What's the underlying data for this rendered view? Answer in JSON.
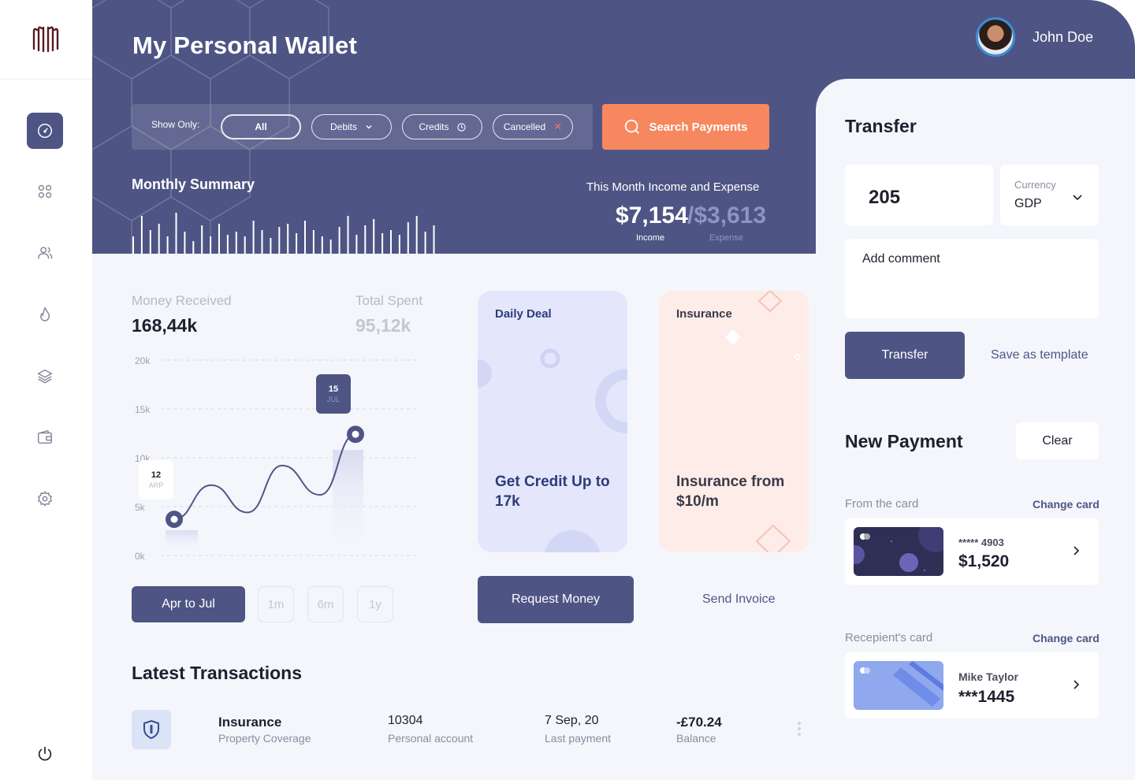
{
  "app": {
    "title": "My Personal Wallet"
  },
  "user": {
    "name": "John Doe"
  },
  "sidebar": {
    "items": [
      {
        "icon": "gauge-icon"
      },
      {
        "icon": "grid-icon"
      },
      {
        "icon": "users-icon"
      },
      {
        "icon": "flame-icon"
      },
      {
        "icon": "layers-icon"
      },
      {
        "icon": "wallet-icon"
      },
      {
        "icon": "gear-icon"
      }
    ],
    "logout_icon": "power-icon"
  },
  "filters": {
    "label": "Show Only:",
    "options": [
      {
        "label": "All",
        "active": true
      },
      {
        "label": "Debits",
        "icon": "chevron-down-icon"
      },
      {
        "label": "Credits",
        "icon": "clock-icon"
      },
      {
        "label": "Cancelled",
        "icon": "close-icon"
      }
    ],
    "search_label": "Search Payments"
  },
  "summary": {
    "title": "Monthly Summary",
    "period_title": "This Month Income and Expense",
    "income_value": "$7,154",
    "income_label": "Income",
    "expense_value": "/$3,613",
    "expense_label": "Expense"
  },
  "stats": {
    "received_label": "Money Received",
    "received_value": "168,44k",
    "spent_label": "Total Spent",
    "spent_value": "95,12k"
  },
  "chart_data": {
    "type": "line",
    "y_ticks": [
      "20k",
      "15k",
      "10k",
      "5k",
      "0k"
    ],
    "ylim": [
      0,
      20
    ],
    "series": [
      {
        "values": [
          3.7,
          7.2,
          4.4,
          9.2,
          6.2,
          12.4
        ]
      }
    ],
    "annotations": [
      {
        "day": "12",
        "month": "ARP"
      },
      {
        "day": "15",
        "month": "JUL"
      }
    ]
  },
  "range": {
    "button_label": "Apr  to  Jul",
    "periods": [
      "1m",
      "6m",
      "1y"
    ]
  },
  "promos": [
    {
      "kicker": "Daily Deal",
      "title": "Get Credit Up to 17k"
    },
    {
      "kicker": "Insurance",
      "title": "Insurance from $10/m"
    }
  ],
  "actions": {
    "request_money": "Request Money",
    "send_invoice": "Send Invoice"
  },
  "transactions": {
    "title": "Latest Transactions",
    "rows": [
      {
        "name": "Insurance",
        "category": "Property Coverage",
        "account_no": "10304",
        "account_type": "Personal account",
        "date": "7 Sep, 20",
        "date_label": "Last payment",
        "amount": "-£70.24",
        "amount_label": "Balance"
      }
    ]
  },
  "transfer": {
    "title": "Transfer",
    "amount": "205",
    "currency_label": "Currency",
    "currency_value": "GDP",
    "comment_placeholder": "Add comment",
    "transfer_label": "Transfer",
    "save_template_label": "Save as template"
  },
  "new_payment": {
    "title": "New Payment",
    "clear_label": "Clear",
    "from_label": "From the card",
    "change_card_label": "Change card",
    "from_card": {
      "number": "***** 4903",
      "balance": "$1,520"
    },
    "recipient_label": "Recepient's card",
    "recipient_card": {
      "name": "Mike Taylor",
      "number": "***1445"
    }
  },
  "colors": {
    "primary": "#4e5584",
    "accent": "#f7875f",
    "background": "#f4f6fc"
  }
}
